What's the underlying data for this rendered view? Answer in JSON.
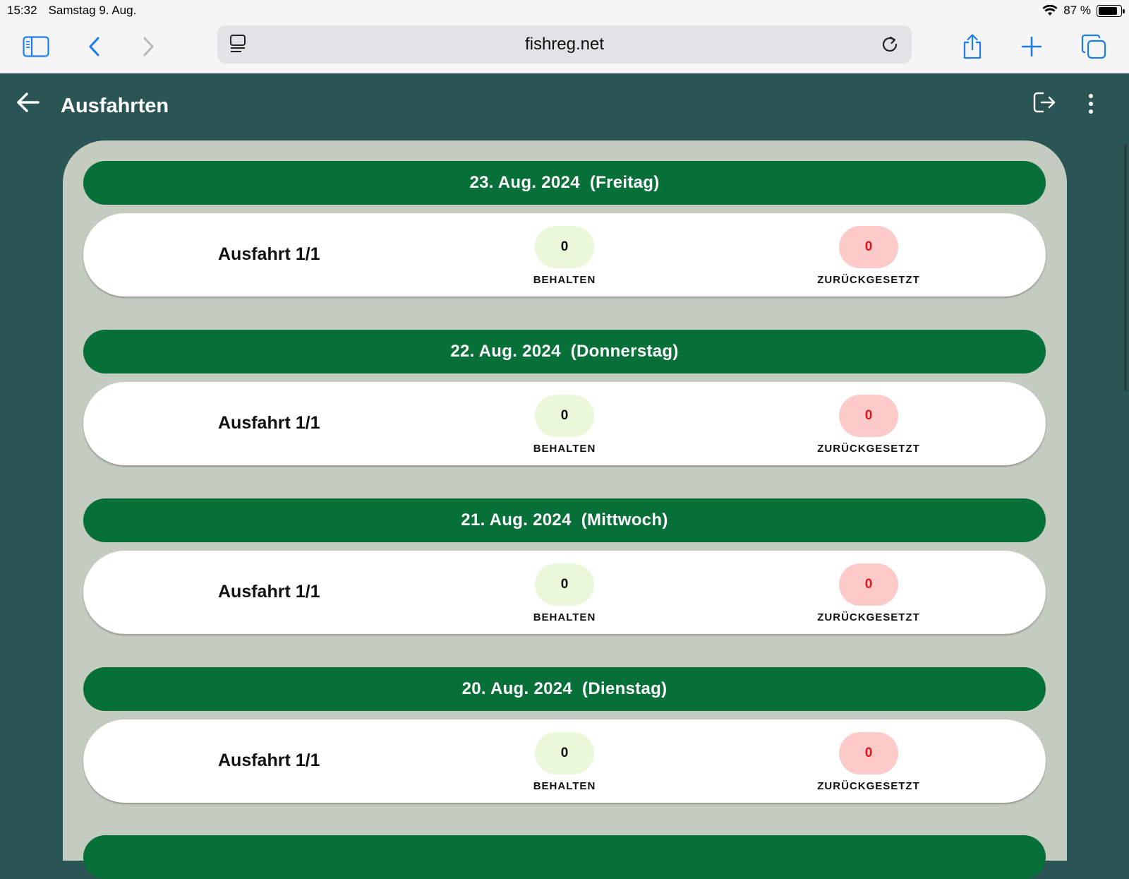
{
  "status_bar": {
    "time": "15:32",
    "date": "Samstag 9. Aug.",
    "battery": "87 %",
    "battery_level": 0.87
  },
  "browser": {
    "url": "fishreg.net"
  },
  "app": {
    "title": "Ausfahrten"
  },
  "trips": [
    {
      "date": "23. Aug. 2024",
      "weekday": "(Freitag)",
      "trip": "Ausfahrt 1/1",
      "kept": "0",
      "kept_label": "BEHALTEN",
      "reset": "0",
      "reset_label": "ZURÜCKGESETZT"
    },
    {
      "date": "22. Aug. 2024",
      "weekday": "(Donnerstag)",
      "trip": "Ausfahrt 1/1",
      "kept": "0",
      "kept_label": "BEHALTEN",
      "reset": "0",
      "reset_label": "ZURÜCKGESETZT"
    },
    {
      "date": "21. Aug. 2024",
      "weekday": "(Mittwoch)",
      "trip": "Ausfahrt 1/1",
      "kept": "0",
      "kept_label": "BEHALTEN",
      "reset": "0",
      "reset_label": "ZURÜCKGESETZT"
    },
    {
      "date": "20. Aug. 2024",
      "weekday": "(Dienstag)",
      "trip": "Ausfahrt 1/1",
      "kept": "0",
      "kept_label": "BEHALTEN",
      "reset": "0",
      "reset_label": "ZURÜCKGESETZT"
    }
  ],
  "colors": {
    "app_background": "#2b5455",
    "panel": "#c4cbbf",
    "date_header": "#077039",
    "kept_pill": "#eaf8d9",
    "reset_pill": "#fdcaca",
    "reset_text": "#e8131a",
    "ios_blue": "#1a7cf0"
  }
}
